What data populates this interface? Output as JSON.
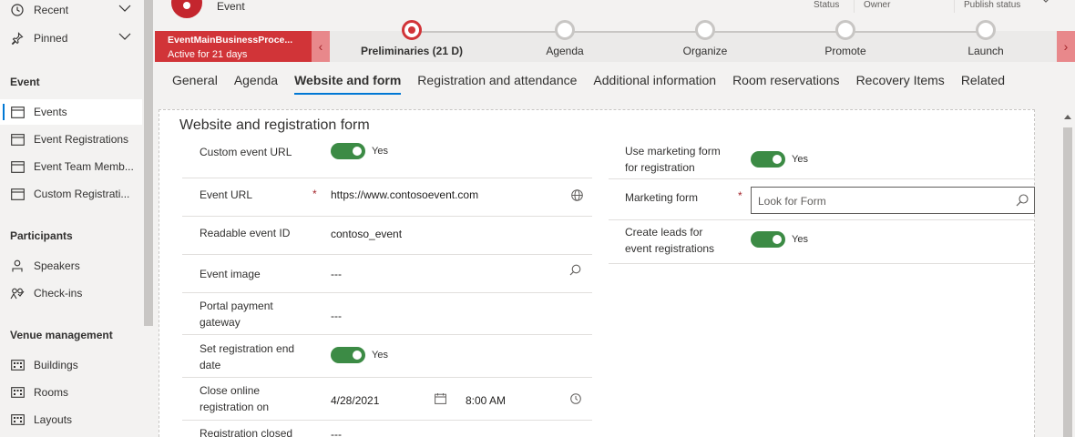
{
  "sidebar": {
    "items": [
      {
        "label": "Recent",
        "icon": "clock-icon"
      },
      {
        "label": "Pinned",
        "icon": "pin-icon"
      },
      {
        "label": "Events",
        "icon": "calendar-icon"
      },
      {
        "label": "Event Registrations",
        "icon": "calendar-icon"
      },
      {
        "label": "Event Team Memb...",
        "icon": "calendar-icon"
      },
      {
        "label": "Custom Registrati...",
        "icon": "calendar-icon"
      },
      {
        "label": "Speakers",
        "icon": "person-icon"
      },
      {
        "label": "Check-ins",
        "icon": "people-icon"
      },
      {
        "label": "Buildings",
        "icon": "building-icon"
      },
      {
        "label": "Rooms",
        "icon": "building-icon"
      },
      {
        "label": "Layouts",
        "icon": "building-icon"
      }
    ],
    "groups": {
      "event": "Event",
      "participants": "Participants",
      "venue": "Venue management"
    }
  },
  "header": {
    "entity": "Event",
    "fields": [
      "Status",
      "Owner",
      "Publish status"
    ]
  },
  "process": {
    "name": "EventMainBusinessProce...",
    "status": "Active for 21 days",
    "stages": [
      "Preliminaries  (21 D)",
      "Agenda",
      "Organize",
      "Promote",
      "Launch"
    ],
    "active_stage": 0
  },
  "tabs": [
    "General",
    "Agenda",
    "Website and form",
    "Registration and attendance",
    "Additional information",
    "Room reservations",
    "Recovery Items",
    "Related"
  ],
  "active_tab": 2,
  "form": {
    "section_title": "Website and registration form",
    "left": {
      "custom_url": {
        "label": "Custom event URL",
        "value": "Yes"
      },
      "event_url": {
        "label": "Event URL",
        "value": "https://www.contosoevent.com"
      },
      "readable_id": {
        "label": "Readable event ID",
        "value": "contoso_event"
      },
      "event_image": {
        "label": "Event image",
        "value": "---"
      },
      "portal_payment": {
        "label": "Portal payment gateway",
        "value": "---"
      },
      "set_reg_end": {
        "label": "Set registration end date",
        "value": "Yes"
      },
      "close_online": {
        "label": "Close online registration on",
        "date": "4/28/2021",
        "time": "8:00 AM"
      },
      "reg_closed": {
        "label": "Registration closed",
        "value": "---"
      }
    },
    "right": {
      "use_marketing": {
        "label": "Use marketing form for registration",
        "value": "Yes"
      },
      "marketing_form": {
        "label": "Marketing form",
        "placeholder": "Look for Form"
      },
      "create_leads": {
        "label": "Create leads for event registrations",
        "value": "Yes"
      }
    }
  },
  "colors": {
    "accent": "#0078d4",
    "process_red": "#d13438",
    "toggle_on": "#3c8b45"
  }
}
